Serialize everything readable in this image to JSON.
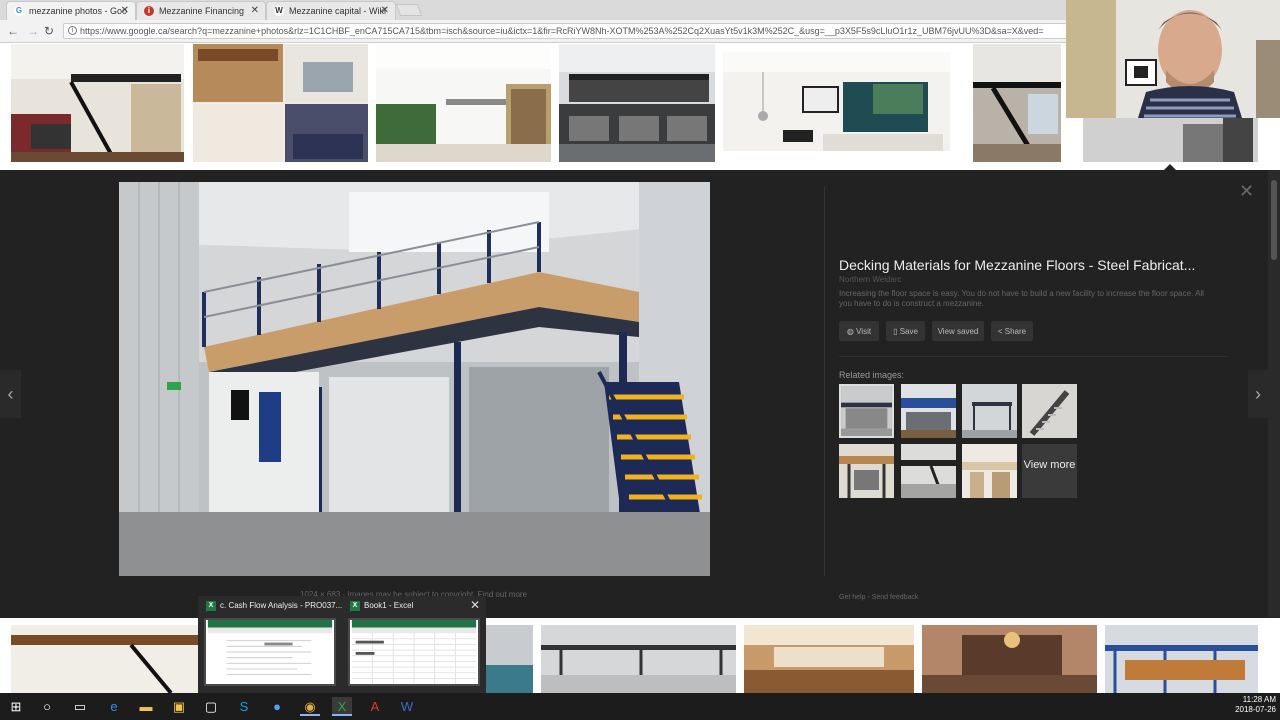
{
  "tabs": [
    {
      "label": "mezzanine photos - Goo",
      "icon": "google-icon",
      "color": "#4285f4",
      "glyph": "G"
    },
    {
      "label": "Mezzanine Financing",
      "icon": "investopedia-icon",
      "color": "#c0392b",
      "glyph": "i"
    },
    {
      "label": "Mezzanine capital - Wiki",
      "icon": "wikipedia-icon",
      "color": "#333333",
      "glyph": "W"
    }
  ],
  "address": {
    "url": "https://www.google.ca/search?q=mezzanine+photos&rlz=1C1CHBF_enCA715CA715&tbm=isch&source=iu&ictx=1&fir=RcRiYW8Nh-XOTM%253A%252Cq2XuasYt5v1k3M%252C_&usg=__p3X5F5s9cLluO1r1z_UBM76jvUU%3D&sa=X&ved="
  },
  "viewer": {
    "title": "Decking Materials for Mezzanine Floors - Steel Fabricat...",
    "site": "Northern Weldarc",
    "description": "Increasing the floor space is easy. You do not have to build a new facility to increase the floor space. All you have to do is construct a mezzanine.",
    "buttons": {
      "visit": "Visit",
      "save": "Save",
      "view_saved": "View saved",
      "share": "Share"
    },
    "related_label": "Related images:",
    "view_more": "View more",
    "dims": "1024 × 683",
    "copyright": "Images may be subject to copyright.",
    "find_out_more": "Find out more",
    "get_help": "Get help",
    "send_feedback": "Send feedback",
    "dot": "-"
  },
  "popup": {
    "window1": "c. Cash Flow Analysis - PRO037...",
    "window2": "Book1 - Excel",
    "app_icon": "X"
  },
  "clock": {
    "time": "11:28 AM",
    "date": "2018-07-26"
  }
}
